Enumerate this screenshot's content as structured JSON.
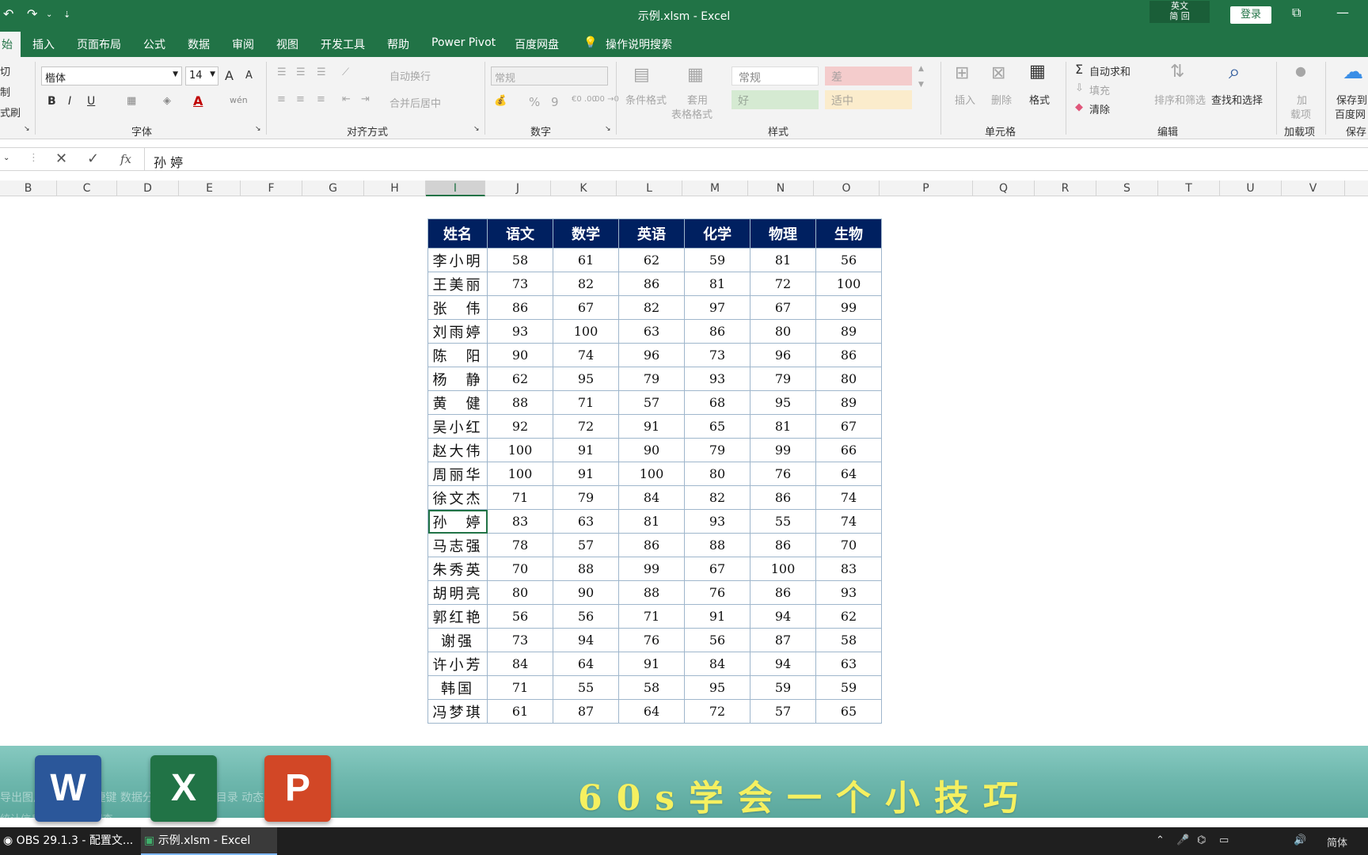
{
  "titlebar": {
    "title": "示例.xlsm  -  Excel",
    "ime_line1": "英文",
    "ime_line2": "简 回",
    "login": "登录",
    "undo_icon": "undo-icon",
    "redo_icon": "redo-icon"
  },
  "menu": {
    "active_tab": "始",
    "items": [
      "插入",
      "页面布局",
      "公式",
      "数据",
      "审阅",
      "视图",
      "开发工具",
      "帮助",
      "Power Pivot",
      "百度网盘",
      "操作说明搜索"
    ]
  },
  "ribbon": {
    "clipboard": {
      "cut": "切",
      "copy": "制",
      "format_painter": "式刷"
    },
    "font": {
      "family": "楷体",
      "size": "14",
      "grow": "A",
      "shrink": "A",
      "bold": "B",
      "italic": "I",
      "underline": "U",
      "font_color": "A",
      "phonetic": "wén",
      "group_label": "字体"
    },
    "alignment": {
      "wrap": "自动换行",
      "merge": "合并后居中",
      "group_label": "对齐方式"
    },
    "number": {
      "format": "常规",
      "percent": "%",
      "comma": "9",
      "inc_dec": "€0 .00",
      "dec_dec": ".00 →0",
      "group_label": "数字"
    },
    "styles": {
      "conditional": "条件格式",
      "table_format_1": "套用",
      "table_format_2": "表格格式",
      "normal": "常规",
      "bad": "差",
      "good": "好",
      "neutral": "适中",
      "group_label": "样式"
    },
    "cells": {
      "insert": "插入",
      "delete": "删除",
      "format": "格式",
      "group_label": "单元格"
    },
    "editing": {
      "autosum": "自动求和",
      "fill": "填充",
      "clear": "清除",
      "sort_filter": "排序和筛选",
      "find_select": "查找和选择",
      "group_label": "编辑"
    },
    "addins": {
      "label_1": "加",
      "label_2": "载项",
      "group_label": "加载项"
    },
    "save": {
      "label_1": "保存到",
      "label_2": "百度网",
      "group_label": "保存"
    }
  },
  "formula_bar": {
    "content": "孙 婷",
    "fx": "fx"
  },
  "columns": [
    "B",
    "C",
    "D",
    "E",
    "F",
    "G",
    "H",
    "I",
    "J",
    "K",
    "L",
    "M",
    "N",
    "O",
    "P",
    "Q",
    "R",
    "S",
    "T",
    "U",
    "V"
  ],
  "selected_column": "I",
  "table": {
    "headers": [
      "姓名",
      "语文",
      "数学",
      "英语",
      "化学",
      "物理",
      "生物"
    ],
    "rows": [
      [
        "李小明",
        "58",
        "61",
        "62",
        "59",
        "81",
        "56"
      ],
      [
        "王美丽",
        "73",
        "82",
        "86",
        "81",
        "72",
        "100"
      ],
      [
        "张　伟",
        "86",
        "67",
        "82",
        "97",
        "67",
        "99"
      ],
      [
        "刘雨婷",
        "93",
        "100",
        "63",
        "86",
        "80",
        "89"
      ],
      [
        "陈　阳",
        "90",
        "74",
        "96",
        "73",
        "96",
        "86"
      ],
      [
        "杨　静",
        "62",
        "95",
        "79",
        "93",
        "79",
        "80"
      ],
      [
        "黄　健",
        "88",
        "71",
        "57",
        "68",
        "95",
        "89"
      ],
      [
        "吴小红",
        "92",
        "72",
        "91",
        "65",
        "81",
        "67"
      ],
      [
        "赵大伟",
        "100",
        "91",
        "90",
        "79",
        "99",
        "66"
      ],
      [
        "周丽华",
        "100",
        "91",
        "100",
        "80",
        "76",
        "64"
      ],
      [
        "徐文杰",
        "71",
        "79",
        "84",
        "82",
        "86",
        "74"
      ],
      [
        "孙　婷",
        "83",
        "63",
        "81",
        "93",
        "55",
        "74"
      ],
      [
        "马志强",
        "78",
        "57",
        "86",
        "88",
        "86",
        "70"
      ],
      [
        "朱秀英",
        "70",
        "88",
        "99",
        "67",
        "100",
        "83"
      ],
      [
        "胡明亮",
        "80",
        "90",
        "88",
        "76",
        "86",
        "93"
      ],
      [
        "郭红艳",
        "56",
        "56",
        "71",
        "91",
        "94",
        "62"
      ],
      [
        "谢强",
        "73",
        "94",
        "76",
        "56",
        "87",
        "58"
      ],
      [
        "许小芳",
        "84",
        "64",
        "91",
        "84",
        "94",
        "63"
      ],
      [
        "韩国",
        "71",
        "55",
        "58",
        "95",
        "59",
        "59"
      ],
      [
        "冯梦琪",
        "61",
        "87",
        "64",
        "72",
        "57",
        "65"
      ]
    ],
    "active_row": 11
  },
  "banner": {
    "slogan": "60s学会一个小技巧",
    "sheet_tabs_ghost": "导出图片  Sheet  快捷键  数据分析  员工信息  目录  动态序号",
    "status_ghost": "统计信息  辅助功能: 调查",
    "apps": [
      "W",
      "X",
      "P"
    ]
  },
  "taskbar": {
    "tasks": [
      "OBS 29.1.3 - 配置文...",
      "示例.xlsm - Excel"
    ],
    "lang": "简体"
  }
}
